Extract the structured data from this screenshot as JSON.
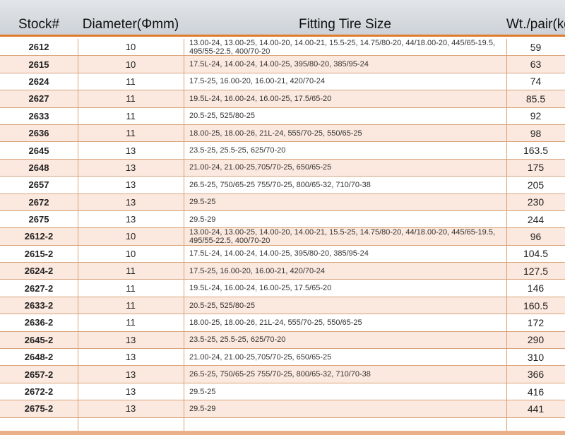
{
  "header": {
    "stock": "Stock#",
    "diameter": "Diameter(Φmm)",
    "fitting": "Fitting Tire Size",
    "weight": "Wt./pair(kg)"
  },
  "rows": [
    {
      "stock": "2612",
      "diameter": "10",
      "fitting": "13.00-24, 13.00-25, 14.00-20, 14.00-21, 15.5-25, 14.75/80-20, 44/18.00-20, 445/65-19.5, 495/55-22.5, 400/70-20",
      "weight": "59"
    },
    {
      "stock": "2615",
      "diameter": "10",
      "fitting": "17.5L-24, 14.00-24, 14.00-25, 395/80-20, 385/95-24",
      "weight": "63"
    },
    {
      "stock": "2624",
      "diameter": "11",
      "fitting": "17.5-25, 16.00-20, 16.00-21, 420/70-24",
      "weight": "74"
    },
    {
      "stock": "2627",
      "diameter": "11",
      "fitting": "19.5L-24, 16.00-24, 16.00-25, 17.5/65-20",
      "weight": "85.5"
    },
    {
      "stock": "2633",
      "diameter": "11",
      "fitting": "20.5-25, 525/80-25",
      "weight": "92"
    },
    {
      "stock": "2636",
      "diameter": "11",
      "fitting": "18.00-25, 18.00-26, 21L-24, 555/70-25, 550/65-25",
      "weight": "98"
    },
    {
      "stock": "2645",
      "diameter": "13",
      "fitting": "23.5-25, 25.5-25, 625/70-20",
      "weight": "163.5"
    },
    {
      "stock": "2648",
      "diameter": "13",
      "fitting": "21.00-24, 21.00-25,705/70-25, 650/65-25",
      "weight": "175"
    },
    {
      "stock": "2657",
      "diameter": "13",
      "fitting": "26.5-25, 750/65-25 755/70-25, 800/65-32, 710/70-38",
      "weight": "205"
    },
    {
      "stock": "2672",
      "diameter": "13",
      "fitting": "29.5-25",
      "weight": "230"
    },
    {
      "stock": "2675",
      "diameter": "13",
      "fitting": "29.5-29",
      "weight": "244"
    },
    {
      "stock": "2612-2",
      "diameter": "10",
      "fitting": "13.00-24, 13.00-25, 14.00-20, 14.00-21, 15.5-25, 14.75/80-20, 44/18.00-20, 445/65-19.5, 495/55-22.5, 400/70-20",
      "weight": "96"
    },
    {
      "stock": "2615-2",
      "diameter": "10",
      "fitting": "17.5L-24, 14.00-24, 14.00-25, 395/80-20, 385/95-24",
      "weight": "104.5"
    },
    {
      "stock": "2624-2",
      "diameter": "11",
      "fitting": "17.5-25, 16.00-20, 16.00-21, 420/70-24",
      "weight": "127.5"
    },
    {
      "stock": "2627-2",
      "diameter": "11",
      "fitting": "19.5L-24, 16.00-24, 16.00-25, 17.5/65-20",
      "weight": "146"
    },
    {
      "stock": "2633-2",
      "diameter": "11",
      "fitting": "20.5-25, 525/80-25",
      "weight": "160.5"
    },
    {
      "stock": "2636-2",
      "diameter": "11",
      "fitting": "18.00-25, 18.00-26, 21L-24, 555/70-25, 550/65-25",
      "weight": "172"
    },
    {
      "stock": "2645-2",
      "diameter": "13",
      "fitting": "23.5-25, 25.5-25, 625/70-20",
      "weight": "290"
    },
    {
      "stock": "2648-2",
      "diameter": "13",
      "fitting": "21.00-24, 21.00-25,705/70-25, 650/65-25",
      "weight": "310"
    },
    {
      "stock": "2657-2",
      "diameter": "13",
      "fitting": "26.5-25, 750/65-25 755/70-25, 800/65-32, 710/70-38",
      "weight": "366"
    },
    {
      "stock": "2672-2",
      "diameter": "13",
      "fitting": "29.5-25",
      "weight": "416"
    },
    {
      "stock": "2675-2",
      "diameter": "13",
      "fitting": "29.5-29",
      "weight": "441"
    }
  ],
  "colors": {
    "accent": "#e07b2c",
    "row_alt": "#fbe8de",
    "header_bg": "#d6dbe0"
  }
}
